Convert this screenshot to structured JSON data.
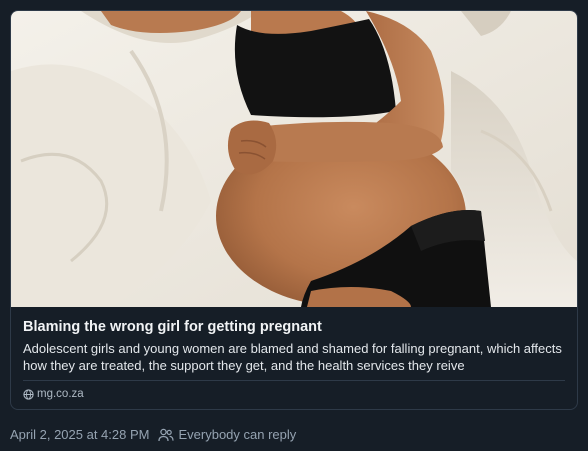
{
  "link_card": {
    "title": "Blaming the wrong girl for getting pregnant",
    "description": "Adolescent girls and young women are blamed and shamed for falling pregnant, which affects how they are treated, the support they get, and the health services they reive",
    "domain": "mg.co.za",
    "domain_icon": "globe-icon",
    "thumbnail_icon": "photo-thumbnail"
  },
  "post_meta": {
    "timestamp": "April 2, 2025 at 4:28 PM",
    "reply_setting": "Everybody can reply",
    "reply_icon": "people-icon"
  },
  "colors": {
    "background": "#161e27",
    "border": "#2e3a48",
    "title_text": "#f1f3f5",
    "muted_text": "#95a3b1"
  }
}
